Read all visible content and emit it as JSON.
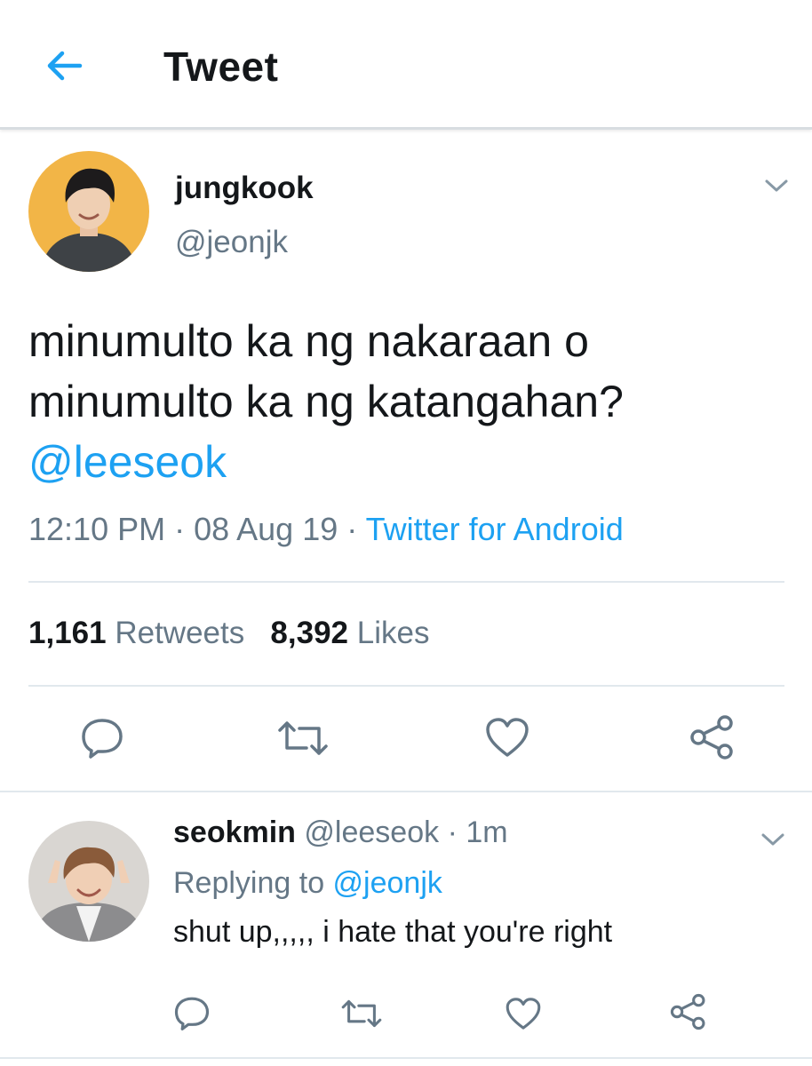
{
  "header": {
    "title": "Tweet"
  },
  "tweet": {
    "display_name": "jungkook",
    "handle": "@jeonjk",
    "text_line1": "minumulto ka ng nakaraan o",
    "text_line2": "minumulto ka ng katangahan?",
    "mention": "@leeseok",
    "time": "12:10 PM",
    "sep1": " · ",
    "date": "08 Aug 19",
    "sep2": " · ",
    "source": "Twitter for Android",
    "retweets_count": "1,161",
    "retweets_label": "Retweets",
    "likes_count": "8,392",
    "likes_label": "Likes"
  },
  "reply": {
    "display_name": "seokmin",
    "handle": "@leeseok",
    "sep": " · ",
    "age": "1m",
    "replying_prefix": "Replying to ",
    "replying_handle": "@jeonjk",
    "text": "shut up,,,,, i hate that you're right"
  },
  "colors": {
    "accent": "#1da1f2",
    "muted": "#657786",
    "divider": "#e1e8ed",
    "text": "#14171a"
  },
  "icons": {
    "back": "arrow-left-icon",
    "menu": "chevron-down-icon",
    "reply": "reply-icon",
    "retweet": "retweet-icon",
    "like": "heart-icon",
    "share": "share-icon"
  }
}
